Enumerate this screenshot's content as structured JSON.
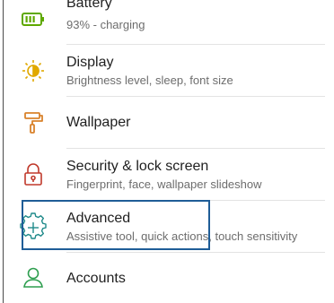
{
  "settings": {
    "items": [
      {
        "id": "battery",
        "title": "Battery",
        "subtitle": "93% - charging",
        "icon": "battery-icon"
      },
      {
        "id": "display",
        "title": "Display",
        "subtitle": "Brightness level, sleep, font size",
        "icon": "display-icon"
      },
      {
        "id": "wallpaper",
        "title": "Wallpaper",
        "subtitle": "",
        "icon": "paint-roller-icon"
      },
      {
        "id": "security",
        "title": "Security & lock screen",
        "subtitle": "Fingerprint, face, wallpaper slideshow",
        "icon": "lock-icon"
      },
      {
        "id": "advanced",
        "title": "Advanced",
        "subtitle": "Assistive tool, quick actions, touch sensitivity",
        "icon": "advanced-gear-icon"
      },
      {
        "id": "accounts",
        "title": "Accounts",
        "subtitle": "",
        "icon": "person-icon"
      }
    ]
  },
  "colors": {
    "battery": "#5ea800",
    "display": "#e0a800",
    "wallpaper": "#d9822b",
    "security": "#c0392b",
    "advanced": "#1f8a8a",
    "accounts": "#2e9e4f",
    "highlight": "#1f5d97"
  }
}
